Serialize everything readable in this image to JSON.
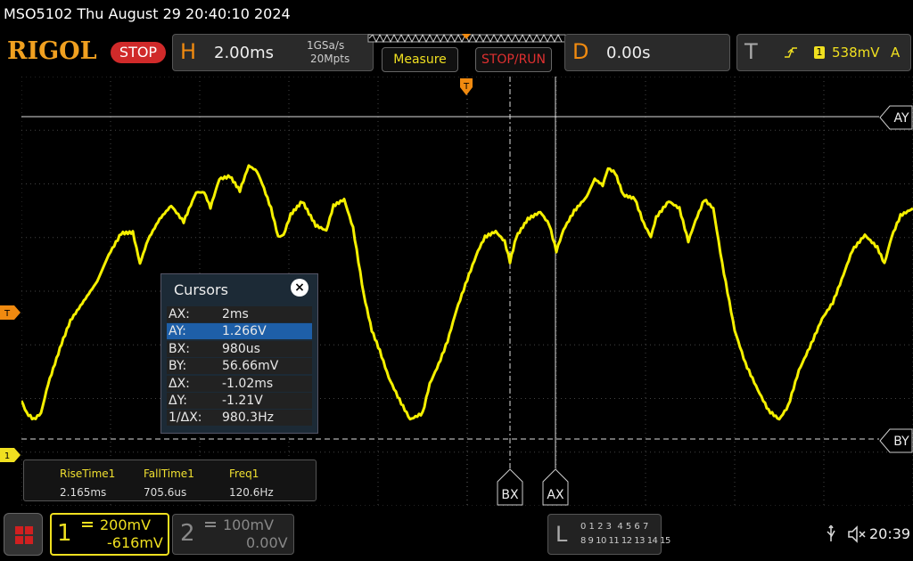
{
  "header": {
    "title": "MSO5102  Thu August 29 20:40:10 2024",
    "logo": "RIGOL",
    "run_state": "STOP",
    "horizontal": {
      "letter": "H",
      "timebase": "2.00ms",
      "sample_rate": "1GSa/s",
      "memory_depth": "20Mpts"
    },
    "measure_label": "Measure",
    "stop_run_label": "STOP/RUN",
    "delay": {
      "letter": "D",
      "value": "0.00s"
    },
    "trigger": {
      "letter": "T",
      "channel": "1",
      "level": "538mV",
      "coupling": "A"
    }
  },
  "markers": {
    "trigger_level": "T",
    "channel_ground": "1",
    "ay_label": "AY",
    "by_label": "BY",
    "bx_label": "BX",
    "ax_label": "AX"
  },
  "cursors": {
    "title": "Cursors",
    "close": "×",
    "rows": [
      {
        "key": "AX:",
        "value": "2ms",
        "selected": false
      },
      {
        "key": "AY:",
        "value": "1.266V",
        "selected": true
      },
      {
        "key": "BX:",
        "value": "980us",
        "selected": false
      },
      {
        "key": "BY:",
        "value": "56.66mV",
        "selected": false
      },
      {
        "key": "ΔX:",
        "value": "-1.02ms",
        "selected": false
      },
      {
        "key": "ΔY:",
        "value": "-1.21V",
        "selected": false
      },
      {
        "key": "1/ΔX:",
        "value": "980.3Hz",
        "selected": false
      }
    ]
  },
  "measurements": [
    {
      "name": "RiseTime1",
      "value": "2.165ms"
    },
    {
      "name": "FallTime1",
      "value": "705.6us"
    },
    {
      "name": "Freq1",
      "value": "120.6Hz"
    }
  ],
  "footer": {
    "ch1": {
      "num": "1",
      "scale": "200mV",
      "offset": "-616mV"
    },
    "ch2": {
      "num": "2",
      "scale": "100mV",
      "offset": "0.00V"
    },
    "logic": {
      "letter": "L",
      "row1": "0 1 2 3  4 5 6 7",
      "row2": "8 9 10 11 12 13 14 15"
    },
    "time": "20:39"
  },
  "colors": {
    "trace": "#f5f000",
    "accent": "#f08a10",
    "stop": "#d02a2a",
    "selected": "#1e5fa8"
  }
}
